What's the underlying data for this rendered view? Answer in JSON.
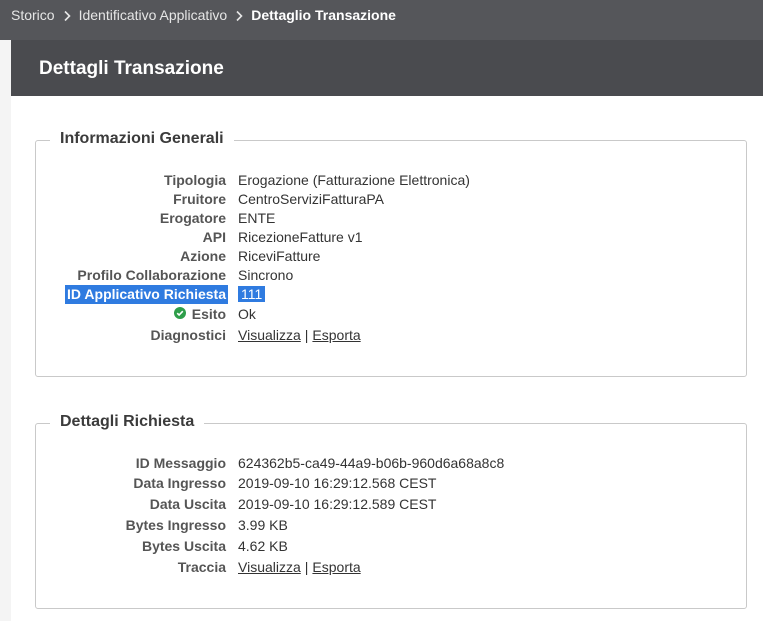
{
  "breadcrumb": {
    "items": [
      "Storico",
      "Identificativo Applicativo"
    ],
    "current": "Dettaglio Transazione"
  },
  "page_title": "Dettagli Transazione",
  "general": {
    "legend": "Informazioni Generali",
    "tipologia": {
      "label": "Tipologia",
      "value": "Erogazione (Fatturazione Elettronica)"
    },
    "fruitore": {
      "label": "Fruitore",
      "value": "CentroServiziFatturaPA"
    },
    "erogatore": {
      "label": "Erogatore",
      "value": "ENTE"
    },
    "api": {
      "label": "API",
      "value": "RicezioneFatture v1"
    },
    "azione": {
      "label": "Azione",
      "value": "RiceviFatture"
    },
    "profilo": {
      "label": "Profilo Collaborazione",
      "value": "Sincrono"
    },
    "id_applicativo": {
      "label": "ID Applicativo Richiesta",
      "value": "111"
    },
    "esito": {
      "label": "Esito",
      "value": "Ok",
      "icon": "check-circle-icon",
      "icon_color": "#2e9e4a"
    },
    "diagnostici": {
      "label": "Diagnostici",
      "view": "Visualizza",
      "sep": "|",
      "export": "Esporta"
    }
  },
  "request": {
    "legend": "Dettagli Richiesta",
    "id_messaggio": {
      "label": "ID Messaggio",
      "value": "624362b5-ca49-44a9-b06b-960d6a68a8c8"
    },
    "data_ingresso": {
      "label": "Data Ingresso",
      "value": "2019-09-10 16:29:12.568 CEST"
    },
    "data_uscita": {
      "label": "Data Uscita",
      "value": "2019-09-10 16:29:12.589 CEST"
    },
    "bytes_ingresso": {
      "label": "Bytes Ingresso",
      "value": "3.99 KB"
    },
    "bytes_uscita": {
      "label": "Bytes Uscita",
      "value": "4.62 KB"
    },
    "traccia": {
      "label": "Traccia",
      "view": "Visualizza",
      "sep": "|",
      "export": "Esporta"
    }
  },
  "colors": {
    "header_bg": "#4a4b4f",
    "breadcrumb_bg": "#55565a",
    "selection": "#2f7be0",
    "success": "#2e9e4a"
  }
}
